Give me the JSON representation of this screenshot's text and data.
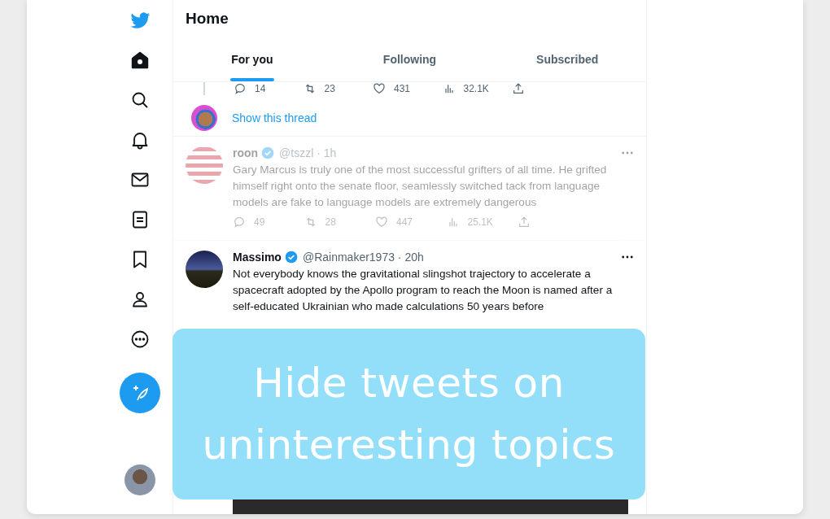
{
  "nav": [
    {
      "kind": "logo"
    },
    {
      "kind": "home",
      "selected": true
    },
    {
      "kind": "search",
      "selected": false
    },
    {
      "kind": "notifications",
      "selected": false
    },
    {
      "kind": "messages",
      "selected": false
    },
    {
      "kind": "lists",
      "selected": false
    },
    {
      "kind": "bookmarks",
      "selected": false
    },
    {
      "kind": "profile",
      "selected": false
    },
    {
      "kind": "more",
      "selected": false
    }
  ],
  "header": {
    "title": "Home"
  },
  "tabs": [
    {
      "label": "For you",
      "selected": true
    },
    {
      "label": "Following",
      "selected": false
    },
    {
      "label": "Subscribed",
      "selected": false
    }
  ],
  "thread_end": {
    "stats": [
      {
        "kind": "reply",
        "count": "14"
      },
      {
        "kind": "retweet",
        "count": "23"
      },
      {
        "kind": "like",
        "count": "431"
      },
      {
        "kind": "views",
        "count": "32.1K"
      },
      {
        "kind": "share"
      }
    ],
    "link": "Show this thread"
  },
  "tweets": [
    {
      "name": "roon",
      "verified": true,
      "meta": "@tszzl · 1h",
      "dimmed": true,
      "text": "Gary Marcus is truly one of the most successful grifters of all time. He grifted himself right onto the senate floor, seamlessly switched tack from language models are fake to language models are extremely dangerous",
      "stats": [
        {
          "kind": "reply",
          "count": "49"
        },
        {
          "kind": "retweet",
          "count": "28"
        },
        {
          "kind": "like",
          "count": "447"
        },
        {
          "kind": "views",
          "count": "25.1K"
        },
        {
          "kind": "share"
        }
      ],
      "photo": false
    },
    {
      "name": "Massimo",
      "verified": true,
      "meta": "@Rainmaker1973 · 20h",
      "dimmed": false,
      "text": "Not everybody knows the gravitational slingshot trajectory to accelerate a spacecraft adopted by the Apollo program to reach the Moon is named after a self-educated Ukrainian who made calculations 50 years before",
      "photo": true
    }
  ],
  "banner": {
    "text": "Hide tweets on uninteresting topics"
  }
}
